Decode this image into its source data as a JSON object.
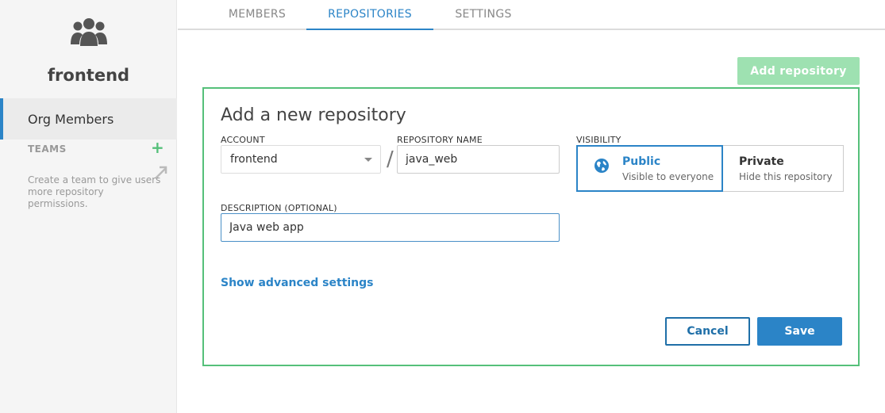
{
  "sidebar": {
    "org_icon": "users-group-icon",
    "org_name": "frontend",
    "nav_item": "Org Members",
    "teams_label": "TEAMS",
    "teams_add_icon": "plus-icon",
    "teams_link_icon": "arrow-up-right-icon",
    "teams_help": "Create a team to give users more repository permissions."
  },
  "tabs": [
    {
      "label": "MEMBERS",
      "active": false
    },
    {
      "label": "REPOSITORIES",
      "active": true
    },
    {
      "label": "SETTINGS",
      "active": false
    }
  ],
  "add_repository_label": "Add repository",
  "form": {
    "title": "Add a new repository",
    "account_label": "ACCOUNT",
    "account_value": "frontend",
    "separator": "/",
    "repo_name_label": "REPOSITORY NAME",
    "repo_name_value": "java_web",
    "visibility_label": "VISIBILITY",
    "visibility": {
      "public_title": "Public",
      "public_sub": "Visible to everyone",
      "public_icon": "globe-icon",
      "private_title": "Private",
      "private_sub": "Hide this repository",
      "selected": "public"
    },
    "description_label": "DESCRIPTION (OPTIONAL)",
    "description_value": "Java web app",
    "advanced_link": "Show advanced settings",
    "cancel_label": "Cancel",
    "save_label": "Save"
  },
  "colors": {
    "accent_blue": "#2b84c7",
    "accent_green": "#55c07a",
    "disabled_green": "#9ee1b1"
  }
}
